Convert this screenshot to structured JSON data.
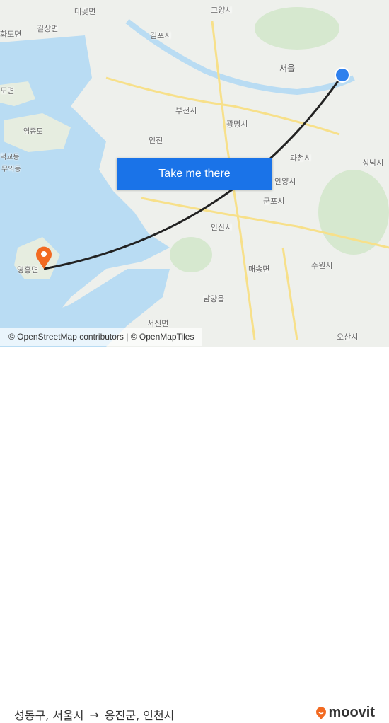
{
  "map": {
    "labels": {
      "goyang": "고양시",
      "gimpo": "김포시",
      "seoul": "서울",
      "bucheon": "부천시",
      "gwangmyeong": "광명시",
      "incheon": "인천",
      "gwacheon": "과천시",
      "seongnam": "성남시",
      "anyang": "안양시",
      "gunpo": "군포시",
      "ansan": "안산시",
      "suwon": "수원시",
      "maesong": "매송면",
      "namyang": "남양읍",
      "seosin": "서신면",
      "osan": "오산시",
      "yeongheung": "영흥면",
      "yeongjong": "영종도",
      "daegot": "대곶면",
      "gilsang": "길상면",
      "hwado": "화도면",
      "mui": "무의동",
      "doedo": "도면",
      "gyodong": "덕교동"
    },
    "colors": {
      "sea": "#b9dcf3",
      "land": "#eef0ec",
      "green": "#d6e8cf",
      "road": "#f7e08a",
      "route": "#222222",
      "origin": "#2f80ed",
      "destination": "#f26a21"
    }
  },
  "cta": {
    "label": "Take me there"
  },
  "attribution": "© OpenStreetMap contributors | © OpenMapTiles",
  "route": {
    "origin": "성동구, 서울시",
    "destination": "옹진군, 인천시",
    "arrow": "→"
  },
  "brand": {
    "name": "moovit"
  }
}
